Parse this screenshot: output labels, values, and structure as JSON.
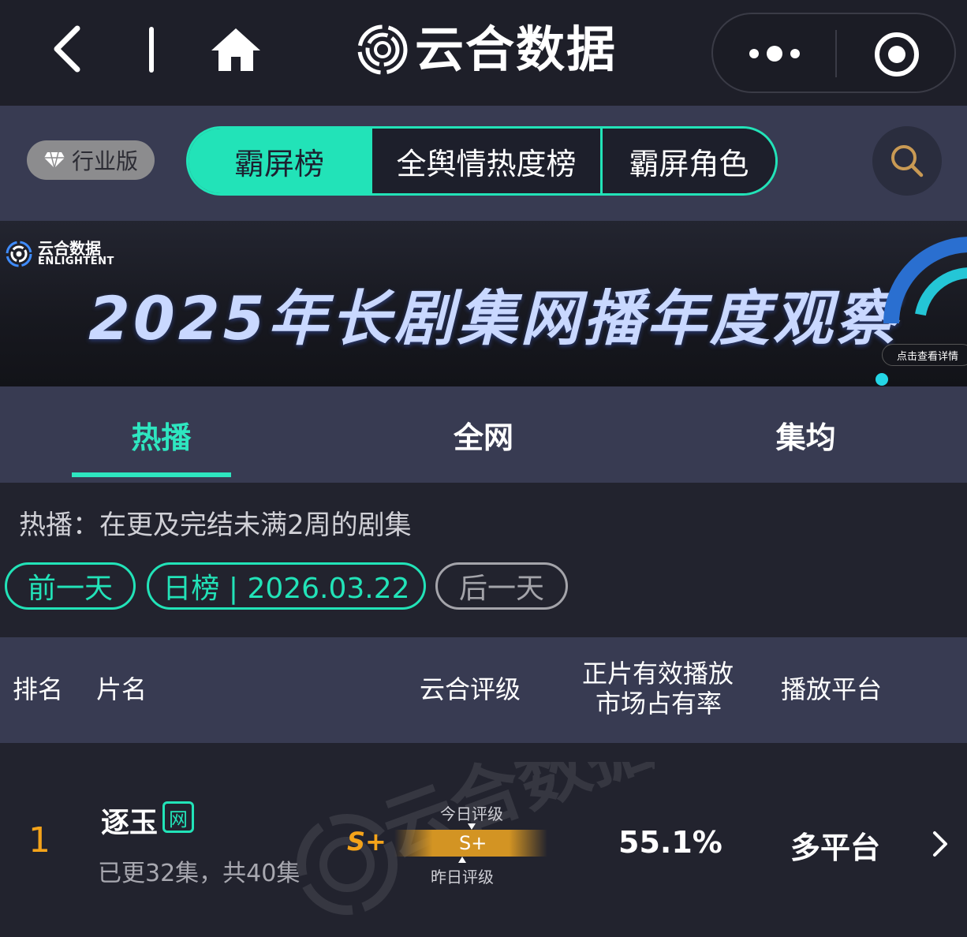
{
  "app": {
    "brand_title": "云合数据",
    "nav_icons": [
      "back-icon",
      "home-icon",
      "more-icon",
      "record-icon"
    ]
  },
  "toolbar": {
    "industry_badge": "行业版",
    "segments": [
      {
        "label": "霸屏榜",
        "active": true
      },
      {
        "label": "全舆情热度榜",
        "active": false
      },
      {
        "label": "霸屏角色",
        "active": false
      }
    ],
    "search_icon": "search-icon"
  },
  "banner": {
    "logo_cn": "云合数据",
    "logo_en": "ENLIGHTENT",
    "title": "2025年长剧集网播年度观察",
    "detail_button": "点击查看详情"
  },
  "tabs": [
    {
      "label": "热播",
      "active": true
    },
    {
      "label": "全网",
      "active": false
    },
    {
      "label": "集均",
      "active": false
    }
  ],
  "description": "热播：在更及完结未满2周的剧集",
  "date_nav": {
    "prev": "前一天",
    "current": "日榜 | 2026.03.22",
    "next": "后一天"
  },
  "table": {
    "headers": {
      "rank": "排名",
      "title": "片名",
      "grade": "云合评级",
      "share_line1": "正片有效播放",
      "share_line2": "市场占有率",
      "platform": "播放平台"
    },
    "rows": [
      {
        "rank": "1",
        "title": "逐玉",
        "tag": "网",
        "episodes": "已更32集，共40集",
        "grade": "S+",
        "bar_grade": "S+",
        "today_label": "今日评级",
        "yesterday_label": "昨日评级",
        "share": "55.1%",
        "platform": "多平台"
      }
    ]
  },
  "colors": {
    "accent": "#22e3b8",
    "rank": "#f4a31a",
    "toolbar_bg": "#383b52",
    "page_bg": "#22232e"
  }
}
